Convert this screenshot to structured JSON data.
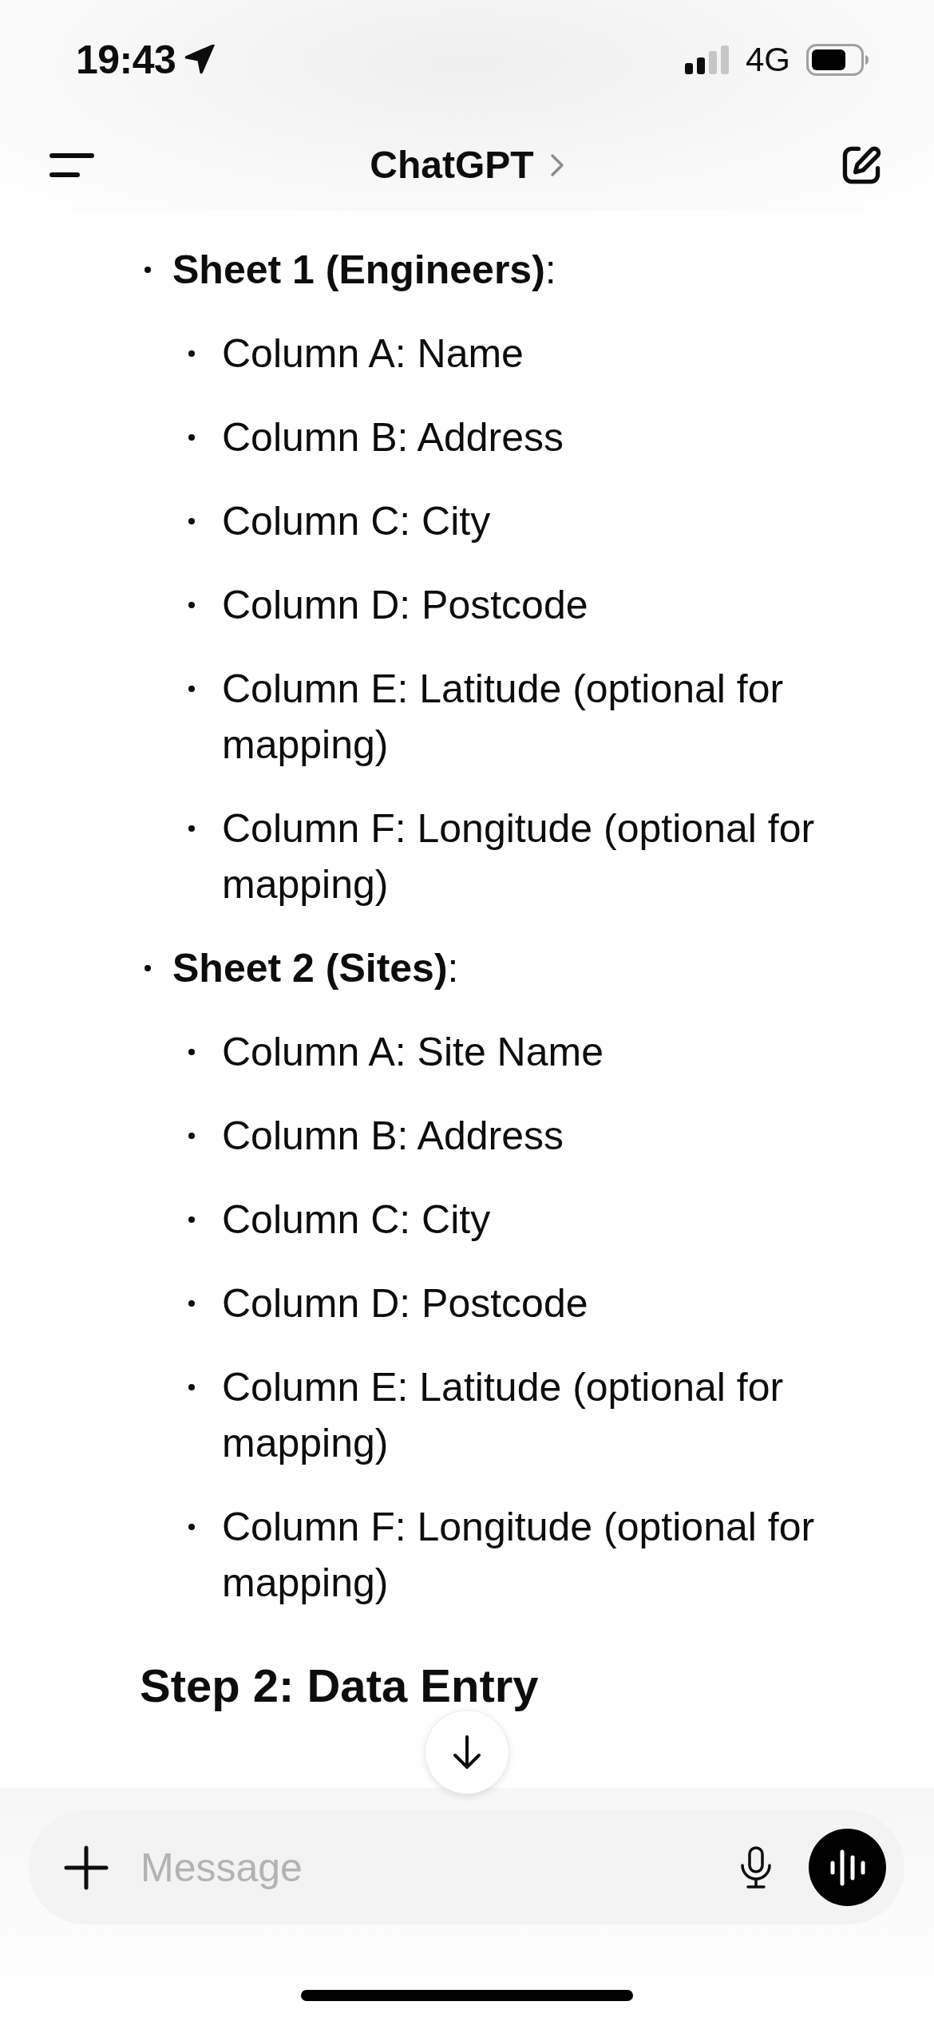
{
  "status_bar": {
    "time": "19:43",
    "network": "4G"
  },
  "header": {
    "title": "ChatGPT"
  },
  "message": {
    "list": [
      {
        "text": "**Sheet 1 (Engineers)**:",
        "children": [
          {
            "text": "Column A: Name"
          },
          {
            "text": "Column B: Address"
          },
          {
            "text": "Column C: City"
          },
          {
            "text": "Column D: Postcode"
          },
          {
            "text": "Column E: Latitude (optional for mapping)"
          },
          {
            "text": "Column F: Longitude (optional for mapping)"
          }
        ]
      },
      {
        "text": "**Sheet 2 (Sites)**:",
        "children": [
          {
            "text": "Column A: Site Name"
          },
          {
            "text": "Column B: Address"
          },
          {
            "text": "Column C: City"
          },
          {
            "text": "Column D: Postcode"
          },
          {
            "text": "Column E: Latitude (optional for mapping)"
          },
          {
            "text": "Column F: Longitude (optional for mapping)"
          }
        ]
      }
    ],
    "heading": "Step 2: Data Entry"
  },
  "composer": {
    "placeholder": "Message"
  }
}
